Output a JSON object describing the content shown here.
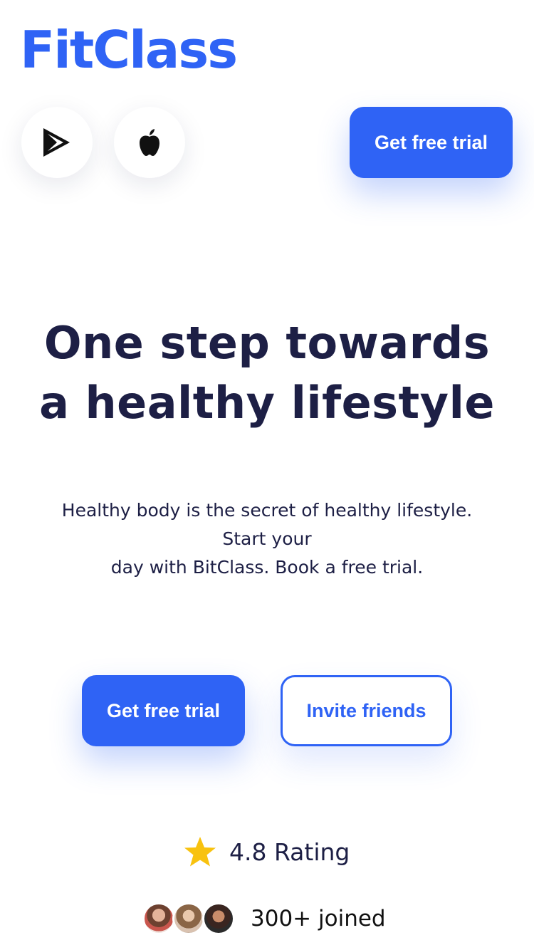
{
  "brand": {
    "logo_text": "FitClass",
    "accent_color": "#2f63f5"
  },
  "header": {
    "store_buttons": [
      {
        "icon": "google-play-icon"
      },
      {
        "icon": "apple-icon"
      }
    ],
    "cta_label": "Get free trial"
  },
  "hero": {
    "headline_lines": [
      "One step towards",
      "a healthy lifestyle"
    ],
    "subtext_lines": [
      "Healthy body is the secret of healthy lifestyle.",
      "Start your",
      "day with BitClass. Book a free trial."
    ],
    "primary_cta": "Get free trial",
    "secondary_cta": "Invite friends"
  },
  "social_proof": {
    "rating_icon": "star-icon",
    "star_color": "#f8c20f",
    "rating_text": "4.8 Rating",
    "avatars": [
      "user-avatar",
      "user-avatar",
      "user-avatar"
    ],
    "joined_text": "300+ joined"
  }
}
